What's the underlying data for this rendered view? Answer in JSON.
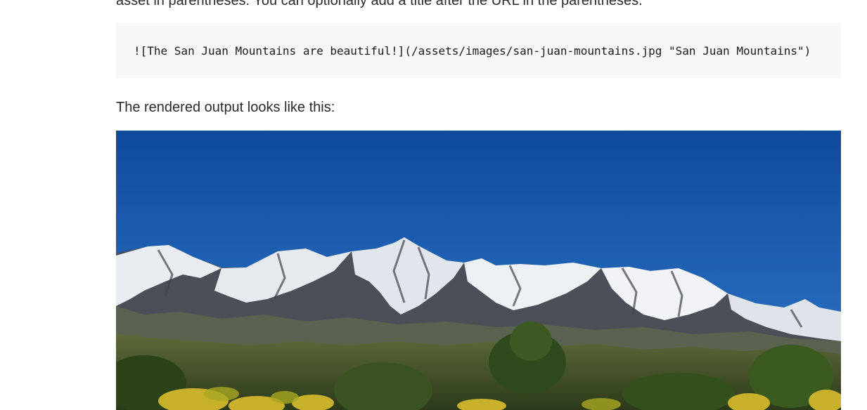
{
  "article": {
    "intro_text": "asset in parentheses. You can optionally add a title after the URL in the parentheses.",
    "code_snippet": "![The San Juan Mountains are beautiful!](/assets/images/san-juan-mountains.jpg \"San Juan Mountains\")",
    "caption": "The rendered output looks like this:"
  },
  "image": {
    "subject": "san-juan-mountains-photo",
    "sky_color": "#1d5cad",
    "snow_color": "#eef1f4",
    "rock_color": "#4c5058",
    "forest_color": "#3d5222"
  }
}
